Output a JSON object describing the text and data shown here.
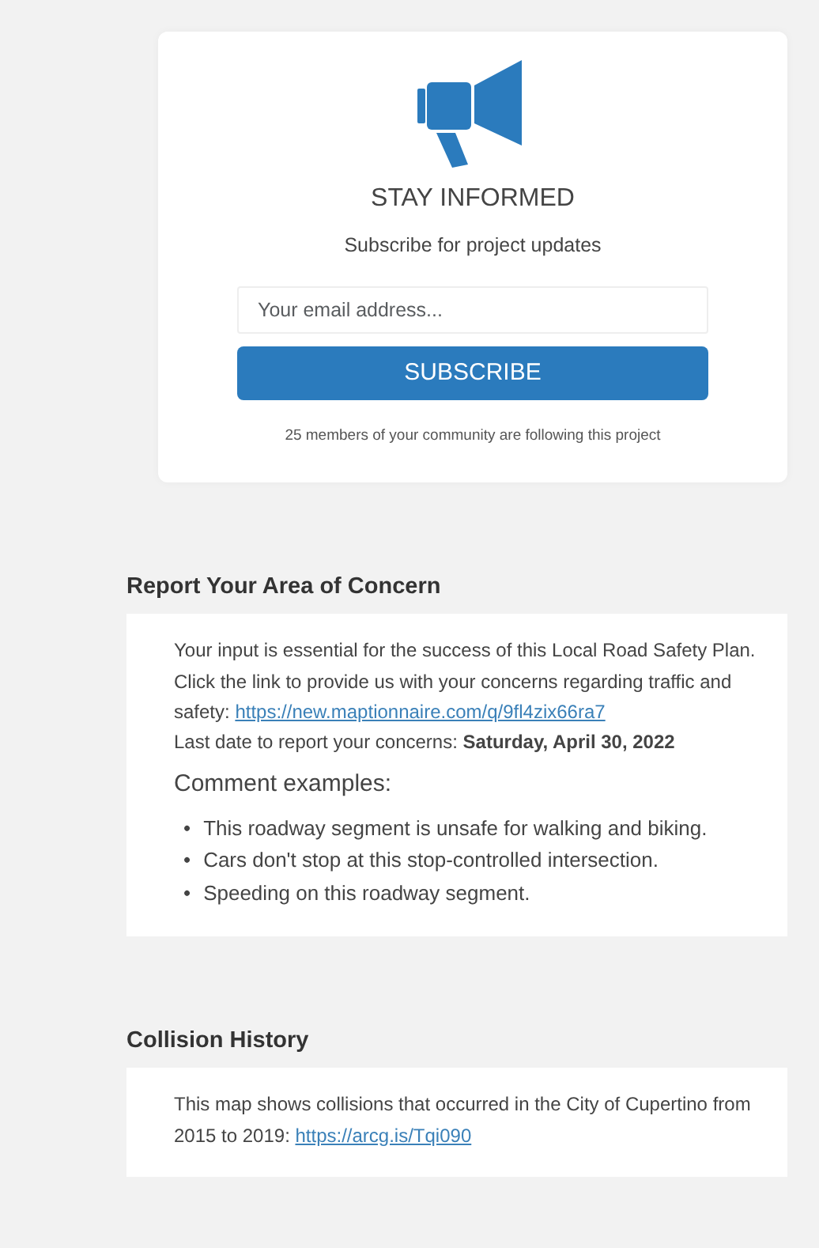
{
  "subscribe": {
    "title": "STAY INFORMED",
    "subtitle": "Subscribe for project updates",
    "email": {
      "placeholder": "Your email address..."
    },
    "button": "SUBSCRIBE",
    "followers": "25 members of your community are following this project"
  },
  "sections": [
    {
      "heading": "Report Your Area of Concern",
      "paragraphs": [
        {
          "text": "Your input is essential for the success of this Local Road Safety Plan. Click the link to provide us with your concerns regarding traffic and safety: ",
          "link": "https://new.maptionnaire.com/q/9fl4zix66ra7"
        },
        {
          "text": "Last date to report your concerns: **Saturday, April 30, 2022**"
        }
      ],
      "subheading": "Comment examples:",
      "bullets": [
        {
          "marker": "•",
          "text": "This roadway segment is unsafe for walking and biking."
        },
        {
          "marker": "•",
          "text": "Cars don't stop at this stop-controlled intersection."
        },
        {
          "marker": "•",
          "text": "Speeding on this roadway segment."
        }
      ]
    },
    {
      "heading": "Collision History",
      "paragraphs": [
        {
          "text": "This map shows collisions that occurred in the City of Cupertino from 2015 to 2019: ",
          "link": "https://arcg.is/Tqi090"
        }
      ]
    }
  ]
}
